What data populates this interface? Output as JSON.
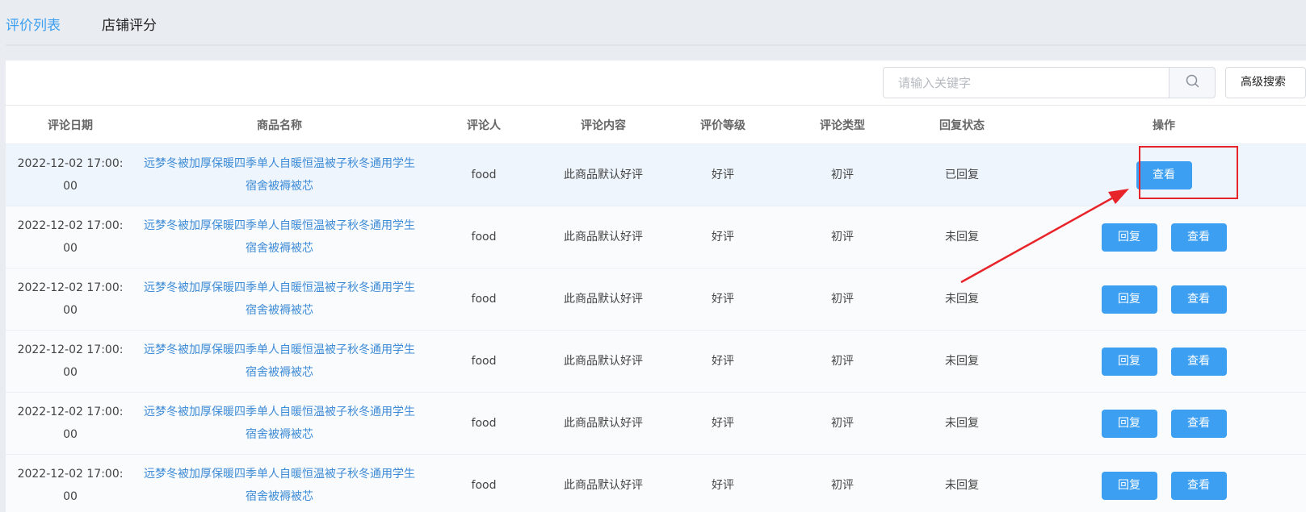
{
  "tabs": [
    {
      "label": "评价列表",
      "active": true
    },
    {
      "label": "店铺评分",
      "active": false
    }
  ],
  "search": {
    "placeholder": "请输入关键字",
    "value": ""
  },
  "advanced_search_label": "高级搜索",
  "columns": [
    "评论日期",
    "商品名称",
    "评论人",
    "评论内容",
    "评价等级",
    "评论类型",
    "回复状态",
    "操作"
  ],
  "rows": [
    {
      "date": "2022-12-02 17:00:00",
      "product": "远梦冬被加厚保暖四季单人自暖恒温被子秋冬通用学生宿舍被褥被芯",
      "user": "food",
      "content": "此商品默认好评",
      "level": "好评",
      "type": "初评",
      "status": "已回复",
      "reply_label": "",
      "view_label": "查看"
    },
    {
      "date": "2022-12-02 17:00:00",
      "product": "远梦冬被加厚保暖四季单人自暖恒温被子秋冬通用学生宿舍被褥被芯",
      "user": "food",
      "content": "此商品默认好评",
      "level": "好评",
      "type": "初评",
      "status": "未回复",
      "reply_label": "回复",
      "view_label": "查看"
    },
    {
      "date": "2022-12-02 17:00:00",
      "product": "远梦冬被加厚保暖四季单人自暖恒温被子秋冬通用学生宿舍被褥被芯",
      "user": "food",
      "content": "此商品默认好评",
      "level": "好评",
      "type": "初评",
      "status": "未回复",
      "reply_label": "回复",
      "view_label": "查看"
    },
    {
      "date": "2022-12-02 17:00:00",
      "product": "远梦冬被加厚保暖四季单人自暖恒温被子秋冬通用学生宿舍被褥被芯",
      "user": "food",
      "content": "此商品默认好评",
      "level": "好评",
      "type": "初评",
      "status": "未回复",
      "reply_label": "回复",
      "view_label": "查看"
    },
    {
      "date": "2022-12-02 17:00:00",
      "product": "远梦冬被加厚保暖四季单人自暖恒温被子秋冬通用学生宿舍被褥被芯",
      "user": "food",
      "content": "此商品默认好评",
      "level": "好评",
      "type": "初评",
      "status": "未回复",
      "reply_label": "回复",
      "view_label": "查看"
    },
    {
      "date": "2022-12-02 17:00:00",
      "product": "远梦冬被加厚保暖四季单人自暖恒温被子秋冬通用学生宿舍被褥被芯",
      "user": "food",
      "content": "此商品默认好评",
      "level": "好评",
      "type": "初评",
      "status": "未回复",
      "reply_label": "回复",
      "view_label": "查看"
    }
  ],
  "colors": {
    "accent": "#3c9ff1",
    "link": "#3d8bd6",
    "annotation": "#e8242b"
  },
  "icons": {
    "search_button": "search-icon"
  }
}
